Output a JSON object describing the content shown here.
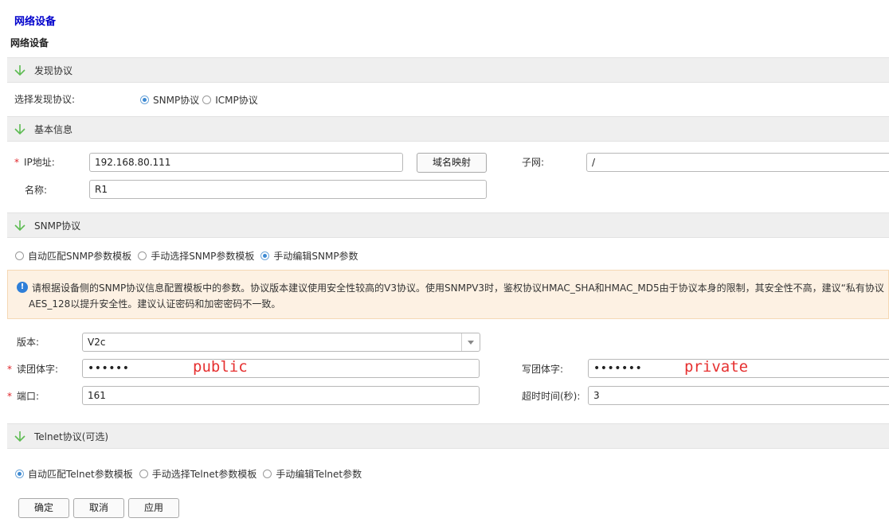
{
  "page": {
    "title": "网络设备",
    "subtitle": "网络设备"
  },
  "discovery": {
    "section_title": "发现协议",
    "label": "选择发现协议:",
    "options": [
      "SNMP协议",
      "ICMP协议"
    ],
    "selected": 0
  },
  "basic": {
    "section_title": "基本信息",
    "ip_label": "IP地址:",
    "ip_value": "192.168.80.111",
    "dns_button": "域名映射",
    "subnet_label": "子网:",
    "subnet_value": "/",
    "name_label": "名称:",
    "name_value": "R1"
  },
  "snmp": {
    "section_title": "SNMP协议",
    "options": [
      "自动匹配SNMP参数模板",
      "手动选择SNMP参数模板",
      "手动编辑SNMP参数"
    ],
    "selected": 2,
    "info_line1": "请根据设备侧的SNMP协议信息配置模板中的参数。协议版本建议使用安全性较高的V3协议。使用SNMPV3时，鉴权协议HMAC_SHA和HMAC_MD5由于协议本身的限制，其安全性不高，建议“私有协议",
    "info_line2": "AES_128以提升安全性。建议认证密码和加密密码不一致。",
    "version_label": "版本:",
    "version_value": "V2c",
    "read_label": "读团体字:",
    "read_value": "••••••",
    "read_annotation": "public",
    "write_label": "写团体字:",
    "write_value": "•••••••",
    "write_annotation": "private",
    "port_label": "端口:",
    "port_value": "161",
    "timeout_label": "超时时间(秒):",
    "timeout_value": "3"
  },
  "telnet": {
    "section_title": "Telnet协议(可选)",
    "options": [
      "自动匹配Telnet参数模板",
      "手动选择Telnet参数模板",
      "手动编辑Telnet参数"
    ],
    "selected": 0
  },
  "footer": {
    "ok": "确定",
    "cancel": "取消",
    "apply": "应用"
  },
  "colors": {
    "accent": "#3e8ad3",
    "required": "#e0262b",
    "annotation": "#e63030",
    "info_bg": "#fdf1e3"
  },
  "icons": {
    "section": "down-arrow-icon",
    "info": "info-icon",
    "dropdown": "chevron-down-icon"
  }
}
